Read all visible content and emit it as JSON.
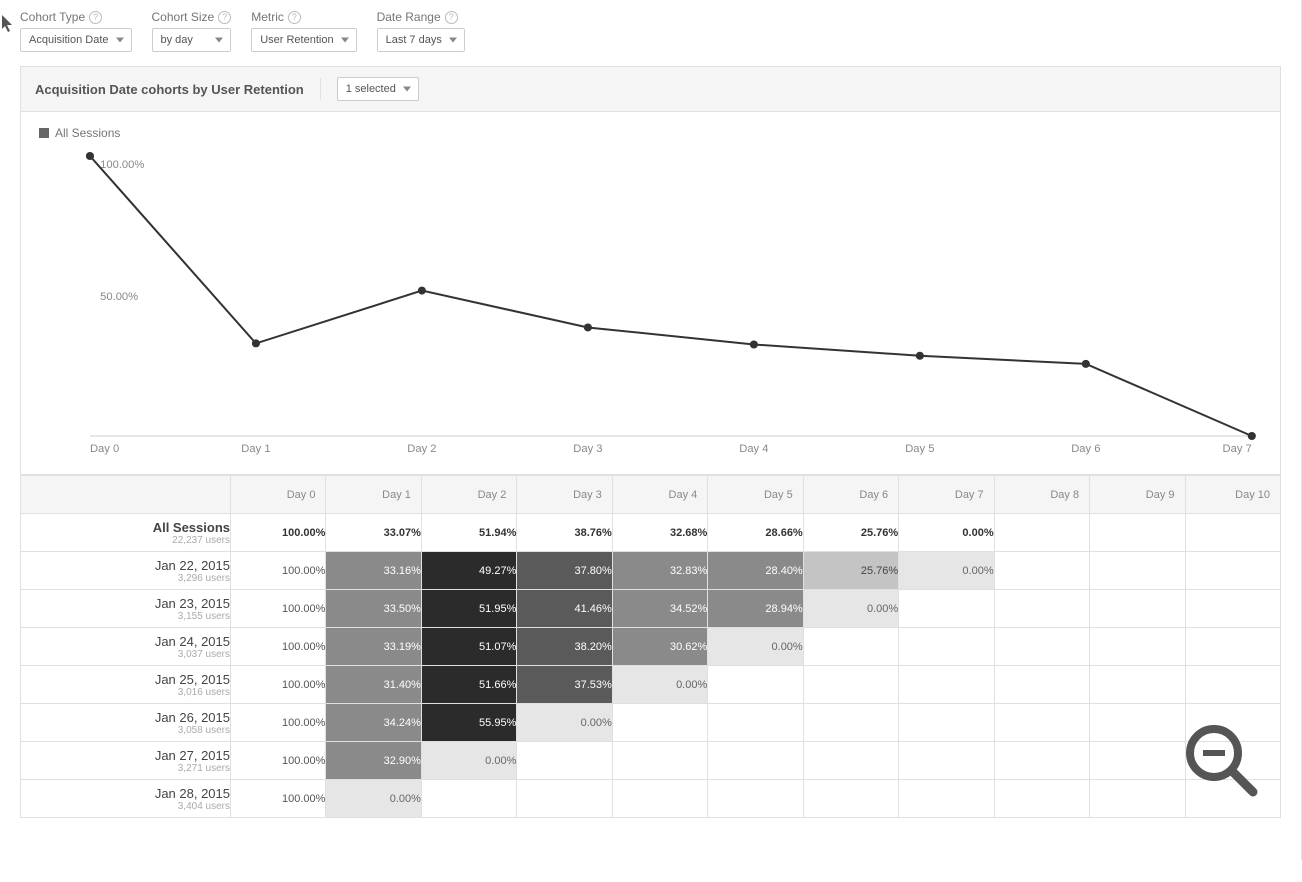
{
  "selectors": {
    "cohort_type": {
      "label": "Cohort Type",
      "value": "Acquisition Date"
    },
    "cohort_size": {
      "label": "Cohort Size",
      "value": "by day"
    },
    "metric": {
      "label": "Metric",
      "value": "User Retention"
    },
    "date_range": {
      "label": "Date Range",
      "value": "Last 7 days"
    }
  },
  "chart_header": {
    "title": "Acquisition Date cohorts by User Retention",
    "selector": "1 selected"
  },
  "legend": {
    "label": "All Sessions"
  },
  "chart_data": {
    "type": "line",
    "categories": [
      "Day 0",
      "Day 1",
      "Day 2",
      "Day 3",
      "Day 4",
      "Day 5",
      "Day 6",
      "Day 7"
    ],
    "series": [
      {
        "name": "All Sessions",
        "values": [
          100.0,
          33.07,
          51.94,
          38.76,
          32.68,
          28.66,
          25.76,
          0.0
        ]
      }
    ],
    "ylabel": "",
    "y_ticks": [
      "100.00%",
      "50.00%"
    ],
    "ylim": [
      0,
      100
    ]
  },
  "table": {
    "day_prefix": "Day ",
    "columns": [
      "Day 0",
      "Day 1",
      "Day 2",
      "Day 3",
      "Day 4",
      "Day 5",
      "Day 6",
      "Day 7",
      "Day 8",
      "Day 9",
      "Day 10"
    ],
    "summary": {
      "label": "All Sessions",
      "users": "22,237 users",
      "values": [
        "100.00%",
        "33.07%",
        "51.94%",
        "38.76%",
        "32.68%",
        "28.66%",
        "25.76%",
        "0.00%",
        "",
        "",
        ""
      ]
    },
    "rows": [
      {
        "label": "Jan 22, 2015",
        "users": "3,296 users",
        "values": [
          "100.00%",
          "33.16%",
          "49.27%",
          "37.80%",
          "32.83%",
          "28.40%",
          "25.76%",
          "0.00%",
          "",
          "",
          ""
        ]
      },
      {
        "label": "Jan 23, 2015",
        "users": "3,155 users",
        "values": [
          "100.00%",
          "33.50%",
          "51.95%",
          "41.46%",
          "34.52%",
          "28.94%",
          "0.00%",
          "",
          "",
          "",
          ""
        ]
      },
      {
        "label": "Jan 24, 2015",
        "users": "3,037 users",
        "values": [
          "100.00%",
          "33.19%",
          "51.07%",
          "38.20%",
          "30.62%",
          "0.00%",
          "",
          "",
          "",
          "",
          ""
        ]
      },
      {
        "label": "Jan 25, 2015",
        "users": "3,016 users",
        "values": [
          "100.00%",
          "31.40%",
          "51.66%",
          "37.53%",
          "0.00%",
          "",
          "",
          "",
          "",
          "",
          ""
        ]
      },
      {
        "label": "Jan 26, 2015",
        "users": "3,058 users",
        "values": [
          "100.00%",
          "34.24%",
          "55.95%",
          "0.00%",
          "",
          "",
          "",
          "",
          "",
          "",
          ""
        ]
      },
      {
        "label": "Jan 27, 2015",
        "users": "3,271 users",
        "values": [
          "100.00%",
          "32.90%",
          "0.00%",
          "",
          "",
          "",
          "",
          "",
          "",
          "",
          ""
        ]
      },
      {
        "label": "Jan 28, 2015",
        "users": "3,404 users",
        "values": [
          "100.00%",
          "0.00%",
          "",
          "",
          "",
          "",
          "",
          "",
          "",
          "",
          ""
        ]
      }
    ]
  }
}
